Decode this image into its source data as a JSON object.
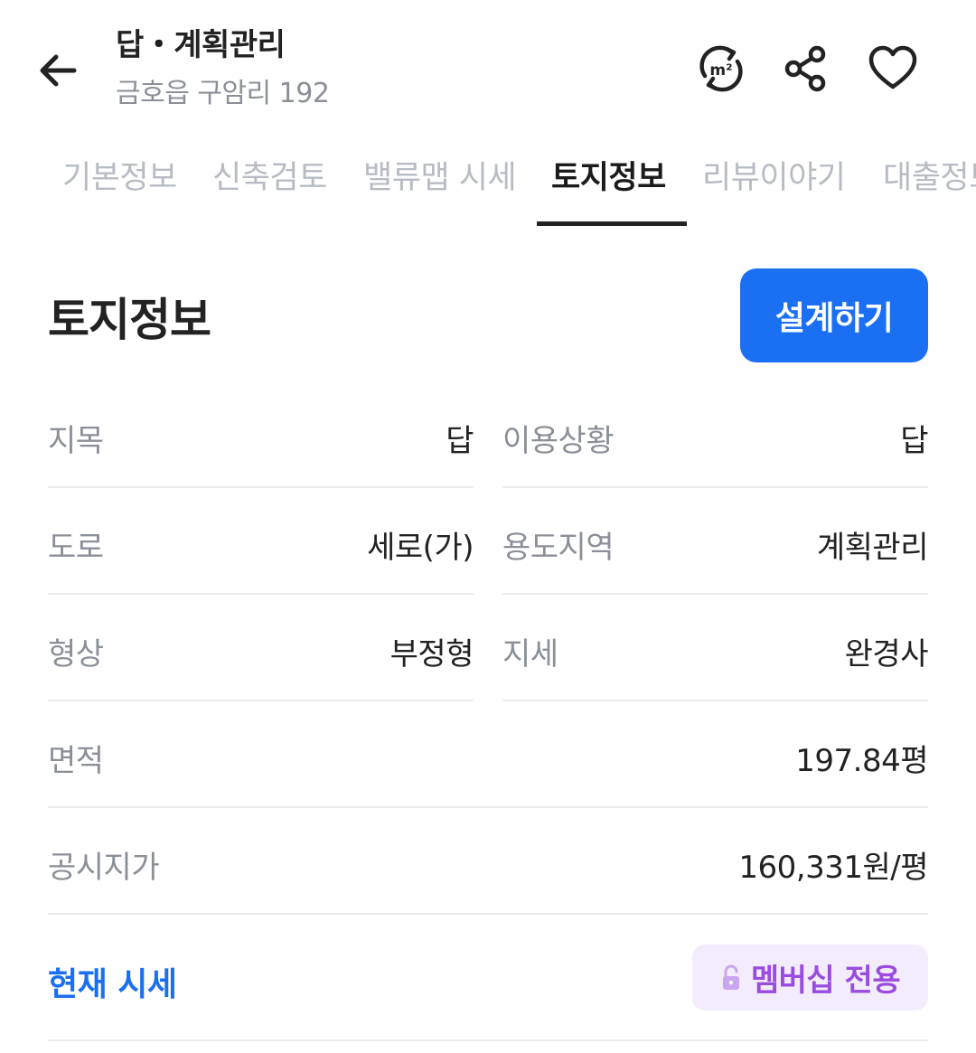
{
  "header": {
    "title": "답・계획관리",
    "subtitle": "금호읍 구암리 192",
    "area_icon_text": "m²"
  },
  "tabs": [
    {
      "label": "기본정보"
    },
    {
      "label": "신축검토"
    },
    {
      "label": "밸류맵 시세"
    },
    {
      "label": "토지정보"
    },
    {
      "label": "리뷰이야기"
    },
    {
      "label": "대출정보"
    }
  ],
  "active_tab": "토지정보",
  "section": {
    "title": "토지정보",
    "design_button": "설계하기"
  },
  "land_info": {
    "jimok": {
      "label": "지목",
      "value": "답"
    },
    "usage_status": {
      "label": "이용상황",
      "value": "답"
    },
    "road": {
      "label": "도로",
      "value": "세로(가)"
    },
    "zoning": {
      "label": "용도지역",
      "value": "계획관리"
    },
    "shape": {
      "label": "형상",
      "value": "부정형"
    },
    "terrain": {
      "label": "지세",
      "value": "완경사"
    },
    "area": {
      "label": "면적",
      "value": "197.84평"
    },
    "official_price": {
      "label": "공시지가",
      "value": "160,331원/평"
    }
  },
  "market": {
    "label": "현재 시세",
    "badge": "멤버십 전용"
  },
  "colors": {
    "accent_blue": "#1a6ff2",
    "membership_purple": "#9a4ce0",
    "membership_bg": "#f3ecfd",
    "label_gray": "#8a8f98",
    "inactive_tab": "#b7bcc4"
  }
}
